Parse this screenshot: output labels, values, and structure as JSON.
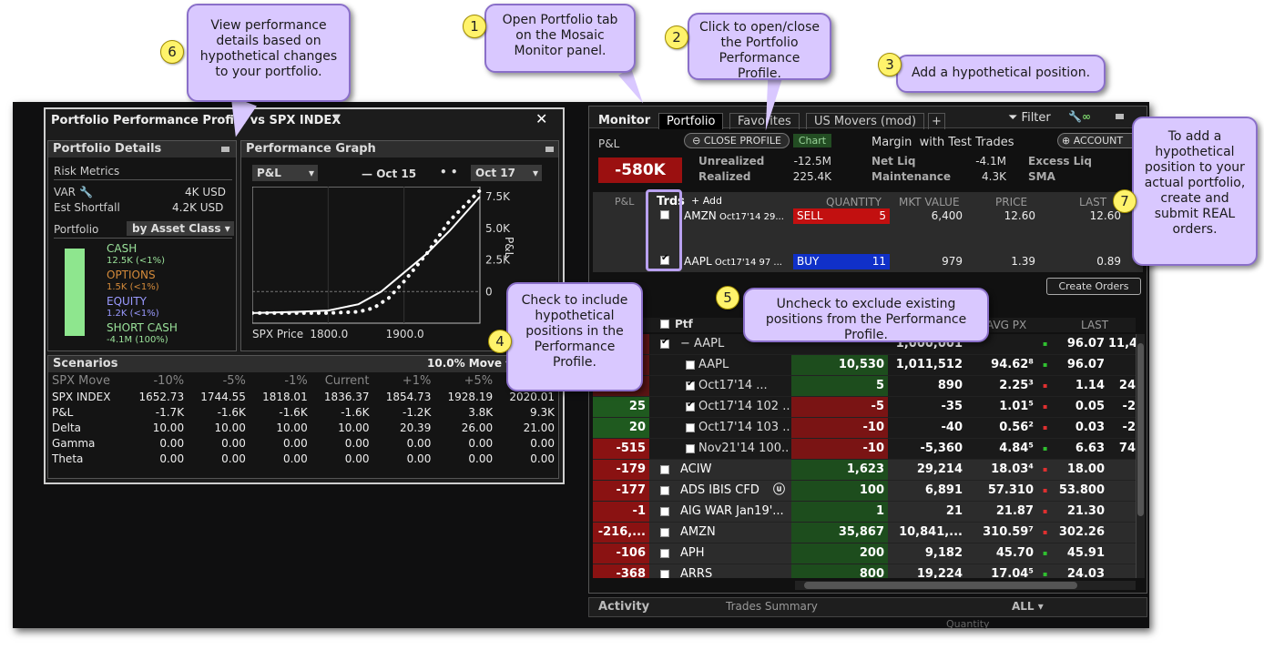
{
  "callouts": [
    {
      "num": "1",
      "text": "Open Portfolio tab on the Mosaic Monitor panel."
    },
    {
      "num": "2",
      "text": "Click to open/close the Portfolio Performance Profile."
    },
    {
      "num": "3",
      "text": "Add a hypothetical position."
    },
    {
      "num": "4",
      "text": "Check to include hypothetical positions in the Performance Profile."
    },
    {
      "num": "5",
      "text": "Uncheck to exclude existing positions from the Performance Profile."
    },
    {
      "num": "6",
      "text": "View performance details based on hypothetical changes to your portfolio."
    },
    {
      "num": "7",
      "text": "To add a hypothetical position to your actual portfolio, create and submit REAL orders."
    }
  ],
  "profile": {
    "title": "Portfolio Performance Profile vs SPX INDEX",
    "details": {
      "title": "Portfolio Details",
      "risk_metrics": "Risk Metrics",
      "var_label": "VAR",
      "var_value": "4K USD",
      "es_label": "Est Shortfall",
      "es_value": "4.2K USD",
      "portfolio_label": "Portfolio",
      "group_by": "by Asset Class",
      "assets": [
        {
          "name": "CASH",
          "value": "12.5K (<1%)",
          "color": "#9be39b"
        },
        {
          "name": "OPTIONS",
          "value": "1.5K (<1%)",
          "color": "#d48a3a"
        },
        {
          "name": "EQUITY",
          "value": "1.2K (<1%)",
          "color": "#9a9aff"
        },
        {
          "name": "SHORT CASH",
          "value": "-4.1M (100%)",
          "color": "#9be39b"
        }
      ]
    },
    "graph": {
      "title": "Performance Graph",
      "metric": "P&L",
      "legend1": "Oct 15",
      "legend2": "Oct 17",
      "ylabel": "P&L",
      "xlabel": "SPX Price"
    },
    "scenarios": {
      "title": "Scenarios",
      "move": "10.0% Move",
      "header": [
        "SPX Move",
        "-10%",
        "-5%",
        "-1%",
        "Current",
        "+1%",
        "+5%",
        "+10%"
      ],
      "rows": [
        [
          "SPX INDEX",
          "1652.73",
          "1744.55",
          "1818.01",
          "1836.37",
          "1854.73",
          "1928.19",
          "2020.01"
        ],
        [
          "P&L",
          "-1.7K",
          "-1.6K",
          "-1.6K",
          "-1.6K",
          "-1.2K",
          "3.8K",
          "9.3K"
        ],
        [
          "Delta",
          "10.00",
          "10.00",
          "10.00",
          "10.00",
          "20.39",
          "26.00",
          "21.00"
        ],
        [
          "Gamma",
          "0.00",
          "0.00",
          "0.00",
          "0.00",
          "0.00",
          "0.00",
          "0.00"
        ],
        [
          "Theta",
          "0.00",
          "0.00",
          "0.00",
          "0.00",
          "0.00",
          "0.00",
          "0.00"
        ]
      ]
    }
  },
  "chart_data": {
    "type": "line",
    "title": "",
    "xlabel": "SPX Price",
    "ylabel": "P&L",
    "x_ticks": [
      "1800.0",
      "1900.0"
    ],
    "y_ticks": [
      "7.5K",
      "5.0K",
      "2.5K",
      "0"
    ],
    "series": [
      {
        "name": "Oct 15",
        "x": [
          1700,
          1760,
          1800,
          1840,
          1870,
          1900,
          1930,
          1960,
          2000
        ],
        "y": [
          -1.7,
          -1.6,
          -1.5,
          -1.0,
          0,
          1.5,
          3.0,
          4.8,
          7.5
        ]
      },
      {
        "name": "Oct 17",
        "x": [
          1700,
          1760,
          1800,
          1840,
          1860,
          1880,
          1900,
          1930,
          1960,
          2000
        ],
        "y": [
          -1.7,
          -1.7,
          -1.7,
          -1.6,
          -1.3,
          -0.5,
          0.8,
          3.0,
          5.6,
          8.0
        ]
      }
    ]
  },
  "monitor": {
    "tabs": [
      "Monitor",
      "Portfolio",
      "Favorites",
      "US Movers (mod)"
    ],
    "filter": "Filter",
    "pl_label": "P&L",
    "close_profile": "CLOSE PROFILE",
    "chart": "Chart",
    "margin": "Margin",
    "with_test": "with Test Trades",
    "account": "ACCOUNT",
    "pl_value": "-580K",
    "unrealized_label": "Unrealized",
    "unrealized": "-12.5M",
    "realized_label": "Realized",
    "realized": "225.4K",
    "netliq_label": "Net Liq",
    "netliq": "-4.1M",
    "maint_label": "Maintenance",
    "maint": "4.3K",
    "excess_label": "Excess Liq",
    "sma_label": "SMA",
    "hyp_cols": [
      "P&L",
      "Trds",
      "+ Add",
      "QUANTITY",
      "MKT VALUE",
      "PRICE",
      "LAST"
    ],
    "hyp": [
      {
        "sym": "AMZN",
        "desc": "Oct17'14 29...",
        "side": "SELL",
        "qty": "5",
        "mkt": "6,400",
        "price": "12.60",
        "last": "12.60"
      },
      {
        "sym": "AAPL",
        "desc": "Oct17'14 97 ...",
        "side": "BUY",
        "qty": "11",
        "mkt": "979",
        "price": "1.39",
        "last": "0.89"
      }
    ],
    "create_orders": "Create Orders",
    "pos_cols": [
      "Ptf",
      "AVG PX",
      "LAST"
    ],
    "positions": [
      {
        "pl": "",
        "sym": "AAPL",
        "qty": "",
        "mkt": "1,000,001",
        "avg": "",
        "last": "96.07",
        "extra": "11,4",
        "kind": "group"
      },
      {
        "pl": "",
        "sym": "AAPL",
        "qty": "10,530",
        "mkt": "1,011,512",
        "avg": "94.62⁸",
        "last": "96.07",
        "extra": "",
        "kind": "child"
      },
      {
        "pl": "",
        "sym": "Oct17'14 ...",
        "qty": "5",
        "mkt": "890",
        "avg": "2.25³",
        "last": "1.14",
        "extra": "24",
        "kind": "child"
      },
      {
        "pl": "25",
        "sym": "Oct17'14 102 ...",
        "qty": "-5",
        "mkt": "-35",
        "avg": "1.01⁵",
        "last": "0.05",
        "extra": "-2",
        "kind": "child"
      },
      {
        "pl": "20",
        "sym": "Oct17'14 103 ...",
        "qty": "-10",
        "mkt": "-40",
        "avg": "0.56²",
        "last": "0.03",
        "extra": "-2",
        "kind": "child"
      },
      {
        "pl": "-515",
        "sym": "Nov21'14 100...",
        "qty": "-10",
        "mkt": "-5,360",
        "avg": "4.84⁵",
        "last": "6.63",
        "extra": "74",
        "kind": "child"
      },
      {
        "pl": "-179",
        "sym": "ACIW",
        "qty": "1,623",
        "mkt": "29,214",
        "avg": "18.03⁴",
        "last": "18.00",
        "extra": "",
        "kind": "top"
      },
      {
        "pl": "-177",
        "sym": "ADS IBIS CFD",
        "qty": "100",
        "mkt": "6,891",
        "avg": "57.310",
        "last": "53.800",
        "extra": "",
        "kind": "top"
      },
      {
        "pl": "-1",
        "sym": "AIG WAR Jan19'...",
        "qty": "1",
        "mkt": "21",
        "avg": "21.87",
        "last": "21.30",
        "extra": "",
        "kind": "top"
      },
      {
        "pl": "-216,...",
        "sym": "AMZN",
        "qty": "35,867",
        "mkt": "10,841,...",
        "avg": "310.59⁷",
        "last": "302.26",
        "extra": "",
        "kind": "top"
      },
      {
        "pl": "-106",
        "sym": "APH",
        "qty": "200",
        "mkt": "9,182",
        "avg": "45.70",
        "last": "45.91",
        "extra": "",
        "kind": "top"
      },
      {
        "pl": "-368",
        "sym": "ARRS",
        "qty": "800",
        "mkt": "19,224",
        "avg": "17.04⁵",
        "last": "24.03",
        "extra": "",
        "kind": "top"
      }
    ],
    "activity_tab": "Activity",
    "trades_tab": "Trades Summary",
    "all": "ALL",
    "quantity": "Quantity"
  }
}
